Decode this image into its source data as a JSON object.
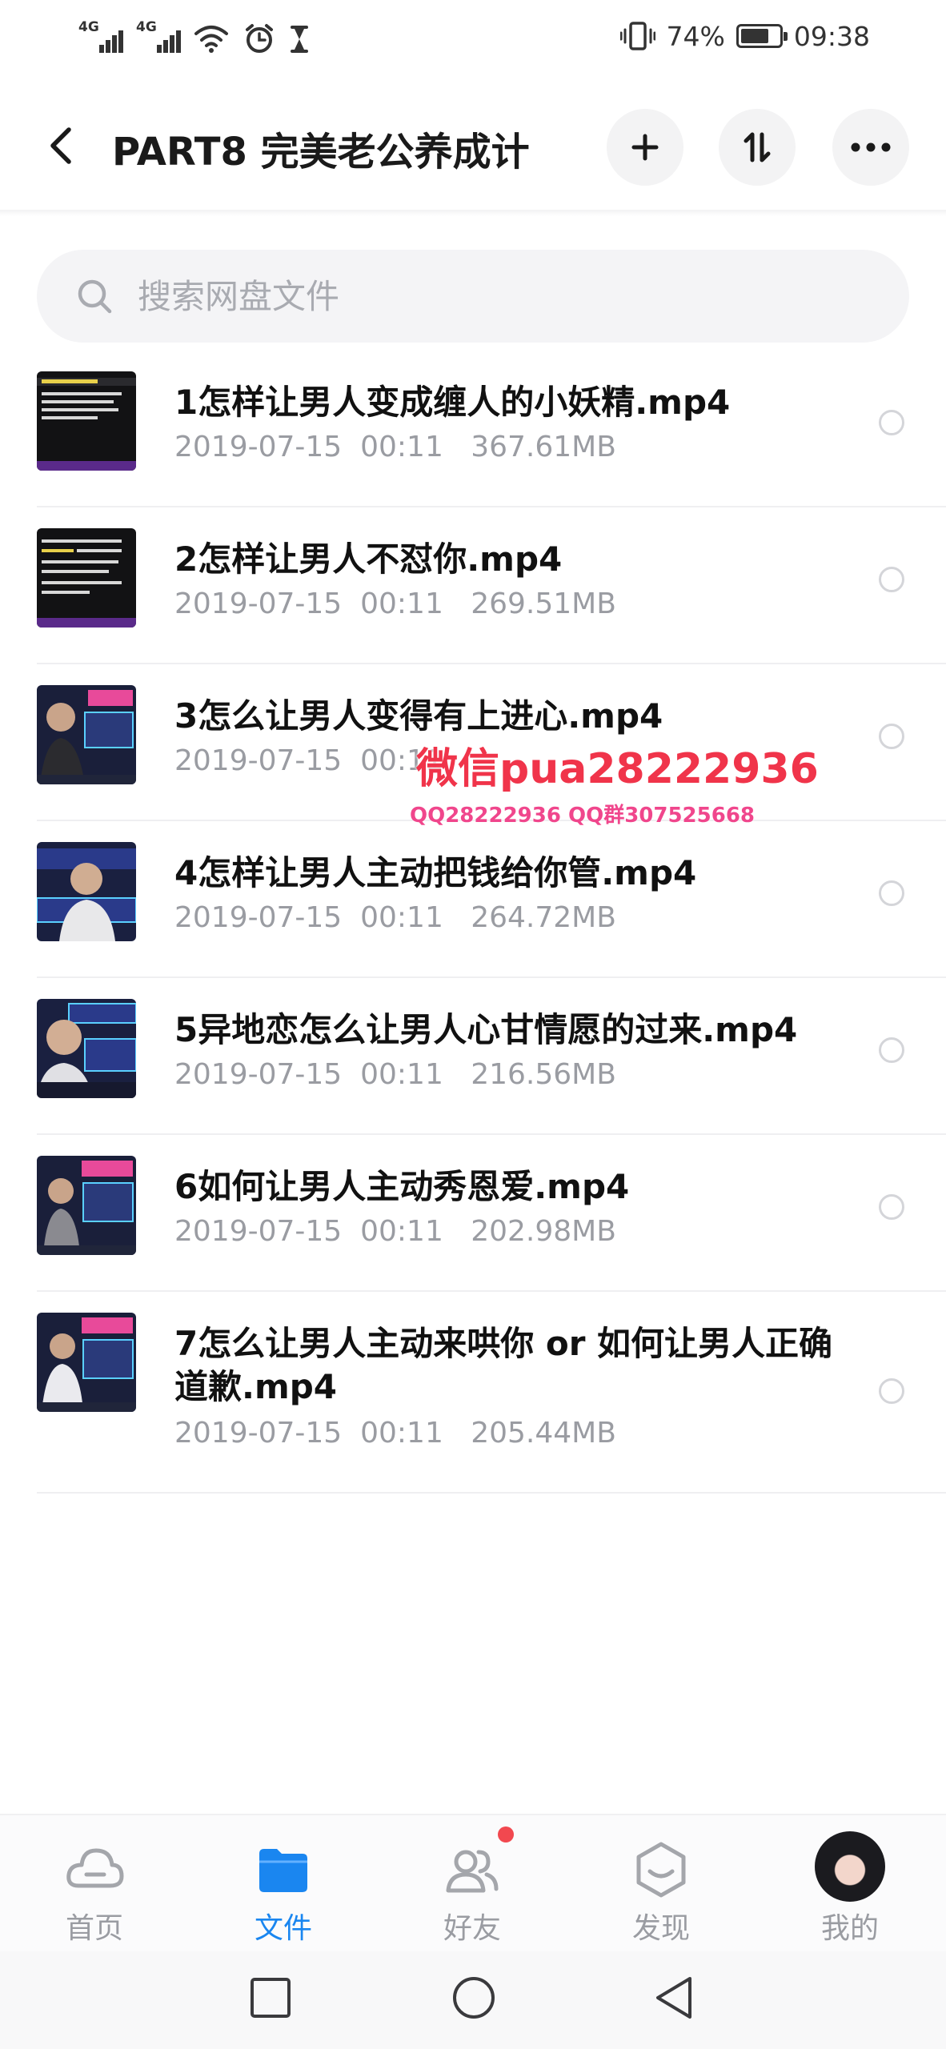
{
  "status_bar": {
    "network_1": "4G",
    "network_2": "4G",
    "battery_percent": "74%",
    "battery_level": 0.74,
    "time": "09:38"
  },
  "header": {
    "title": "PART8 完美老公养成计",
    "back_icon": "chevron-left-icon",
    "add_icon": "plus-icon",
    "sort_icon": "sort-icon",
    "more_icon": "more-horizontal-icon"
  },
  "search": {
    "placeholder": "搜索网盘文件"
  },
  "files": [
    {
      "name": "1怎样让男人变成缠人的小妖精.mp4",
      "date": "2019-07-15  00:11",
      "size": "367.61MB"
    },
    {
      "name": "2怎样让男人不怼你.mp4",
      "date": "2019-07-15  00:11",
      "size": "269.51MB"
    },
    {
      "name": "3怎么让男人变得有上进心.mp4",
      "date": "2019-07-15  00:11",
      "size": ""
    },
    {
      "name": "4怎样让男人主动把钱给你管.mp4",
      "date": "2019-07-15  00:11",
      "size": "264.72MB"
    },
    {
      "name": "5异地恋怎么让男人心甘情愿的过来.mp4",
      "date": "2019-07-15  00:11",
      "size": "216.56MB"
    },
    {
      "name": "6如何让男人主动秀恩爱.mp4",
      "date": "2019-07-15  00:11",
      "size": "202.98MB"
    },
    {
      "name": "7怎么让男人主动来哄你 or 如何让男人正确道歉.mp4",
      "date": "2019-07-15  00:11",
      "size": "205.44MB"
    }
  ],
  "watermark": {
    "line1": "微信pua28222936",
    "line2": "QQ28222936 QQ群307525668"
  },
  "bottom_nav": [
    {
      "label": "首页",
      "icon": "cloud-icon",
      "active": false
    },
    {
      "label": "文件",
      "icon": "folder-icon",
      "active": true
    },
    {
      "label": "好友",
      "icon": "friends-icon",
      "active": false,
      "badge": true
    },
    {
      "label": "发现",
      "icon": "discover-icon",
      "active": false
    },
    {
      "label": "我的",
      "icon": "avatar",
      "active": false
    }
  ],
  "colors": {
    "accent": "#1a86f0",
    "watermark": "#f0344a",
    "badge": "#f2484f"
  }
}
